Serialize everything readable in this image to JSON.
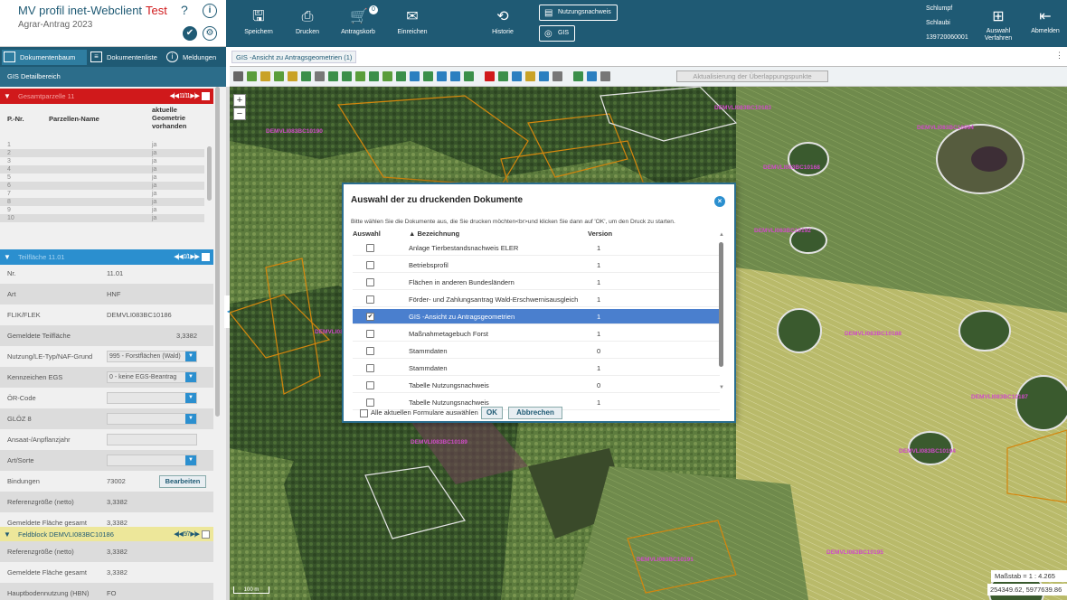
{
  "app": {
    "title": "MV profil inet-Webclient",
    "env": "Test",
    "subtitle": "Agrar-Antrag 2023"
  },
  "toolbar": {
    "save": "Speichern",
    "print": "Drucken",
    "cart": "Antragskorb",
    "cart_badge": "0",
    "submit": "Einreichen",
    "history": "Historie",
    "nutzungsnachweis": "Nutzungsnachweis",
    "gis": "GIS",
    "user_last": "Schlumpf",
    "user_first": "Schlaubi",
    "user_id": "139720060001",
    "select_procedure_1": "Auswahl",
    "select_procedure_2": "Verfahren",
    "logout": "Abmelden"
  },
  "panel_tabs": {
    "doc_tree": "Dokumentenbaum",
    "doc_list": "Dokumentenliste",
    "messages": "Meldungen"
  },
  "gis_detail": "GIS Detailbereich",
  "gesamtparzelle": {
    "header": "Gesamtparzelle 11",
    "nav": "◀|◀ 11/11 ▶|▶",
    "col_nr": "P.-Nr.",
    "col_name": "Parzellen-Name",
    "col_geo": "aktuelle Geometrie vorhanden",
    "rows": [
      {
        "nr": "1",
        "geo": "ja"
      },
      {
        "nr": "2",
        "geo": "ja"
      },
      {
        "nr": "3",
        "geo": "ja"
      },
      {
        "nr": "4",
        "geo": "ja"
      },
      {
        "nr": "5",
        "geo": "ja"
      },
      {
        "nr": "6",
        "geo": "ja"
      },
      {
        "nr": "7",
        "geo": "ja"
      },
      {
        "nr": "8",
        "geo": "ja"
      },
      {
        "nr": "9",
        "geo": "ja"
      },
      {
        "nr": "10",
        "geo": "ja"
      }
    ]
  },
  "teilflaeche": {
    "header": "Teilfläche 11.01",
    "nav": "◀|◀ 1/1 ▶|▶",
    "nr_label": "Nr.",
    "nr_value": "11.01",
    "art_label": "Art",
    "art_value": "HNF",
    "flik_label": "FLIK/FLEK",
    "flik_value": "DEMVLI083BC10186",
    "gem_label": "Gemeldete Teilfläche",
    "gem_value": "3,3382",
    "nutzung_label": "Nutzung/LE-Typ/NAF-Grund",
    "nutzung_value": "995 - Forstflächen (Wald)",
    "kennz_label": "Kennzeichen EGS",
    "kennz_value": "0 - keine EGS-Beantrag",
    "oer_label": "ÖR-Code",
    "gloez_label": "GLÖZ 8",
    "ansaat_label": "Ansaat-/Anpflanzjahr",
    "artsorte_label": "Art/Sorte",
    "bind_label": "Bindungen",
    "bind_value": "73002",
    "edit": "Bearbeiten",
    "ref_label": "Referenzgröße (netto)",
    "ref_value": "3,3382",
    "gesamt_label": "Gemeldete Fläche gesamt",
    "gesamt_value": "3,3382"
  },
  "feldblock": {
    "header": "Feldblock DEMVLI083BC10186",
    "nav": "◀|◀ 5/7 ▶|▶",
    "ref_label": "Referenzgröße (netto)",
    "ref_value": "3,3382",
    "gesamt_label": "Gemeldete Fläche gesamt",
    "gesamt_value": "3,3382",
    "hbn_label": "Hauptbodennutzung (HBN)",
    "hbn_value": "FO"
  },
  "gis": {
    "tab": "GIS -Ansicht zu Antragsgeometrien (1)",
    "overlap_button": "Aktualisierung der Überlappungspunkte",
    "scale": "Maßstab = 1 : 4.265",
    "coords": "254349.62, 5977639.86",
    "scalebar": "100 m",
    "labels": [
      "DEMVLI083BC10190",
      "DEMVLI083BC10183",
      "DEMVLI083BC10094",
      "DEMVLI083BC10168",
      "DEMVLI083BC10192",
      "DEMVLI083BC10193",
      "DEMVLI083BC10188",
      "DEMVLI083BC10187",
      "DEMVLI083BC10189",
      "DEMVLI083BC10194",
      "DEMVLI083BC10191",
      "DEMVLI083BC10195"
    ]
  },
  "modal": {
    "title": "Auswahl der zu druckenden Dokumente",
    "instruction": "Bitte wählen Sie die Dokumente aus, die Sie drucken möchten<br>und klicken Sie dann auf 'OK', um den Druck zu starten.",
    "col_select": "Auswahl",
    "col_name": "▲ Bezeichnung",
    "col_version": "Version",
    "rows": [
      {
        "name": "Anlage Tierbestandsnachweis ELER",
        "version": "1",
        "checked": false
      },
      {
        "name": "Betriebsprofil",
        "version": "1",
        "checked": false
      },
      {
        "name": "Flächen in anderen Bundesländern",
        "version": "1",
        "checked": false
      },
      {
        "name": "Förder- und Zahlungsantrag Wald-Erschwernisausgleich",
        "version": "1",
        "checked": false
      },
      {
        "name": "GIS -Ansicht zu Antragsgeometrien",
        "version": "1",
        "checked": true
      },
      {
        "name": "Maßnahmetagebuch Forst",
        "version": "1",
        "checked": false
      },
      {
        "name": "Stammdaten",
        "version": "0",
        "checked": false
      },
      {
        "name": "Stammdaten",
        "version": "1",
        "checked": false
      },
      {
        "name": "Tabelle Nutzungsnachweis",
        "version": "0",
        "checked": false
      },
      {
        "name": "Tabelle Nutzungsnachweis",
        "version": "1",
        "checked": false
      }
    ],
    "select_all": "Alle aktuellen Formulare auswählen",
    "ok": "OK",
    "cancel": "Abbrechen"
  }
}
